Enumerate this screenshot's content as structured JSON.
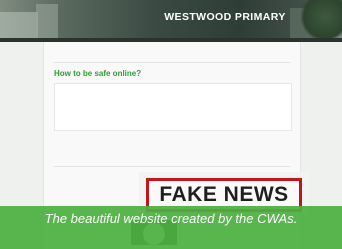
{
  "header": {
    "site_title": "WESTWOOD PRIMARY"
  },
  "content": {
    "intro": "",
    "heading": "How to be safe online?",
    "card_lines": [
      "",
      "",
      "",
      "",
      "",
      "",
      ""
    ],
    "side_text": ""
  },
  "image": {
    "fake_news_label": "FAKE NEWS"
  },
  "caption": "The beautiful website created by the CWAs.",
  "colors": {
    "accent_green": "#2f9e36",
    "caption_bg": "#4caf40",
    "fake_news_border": "#c2161c"
  }
}
